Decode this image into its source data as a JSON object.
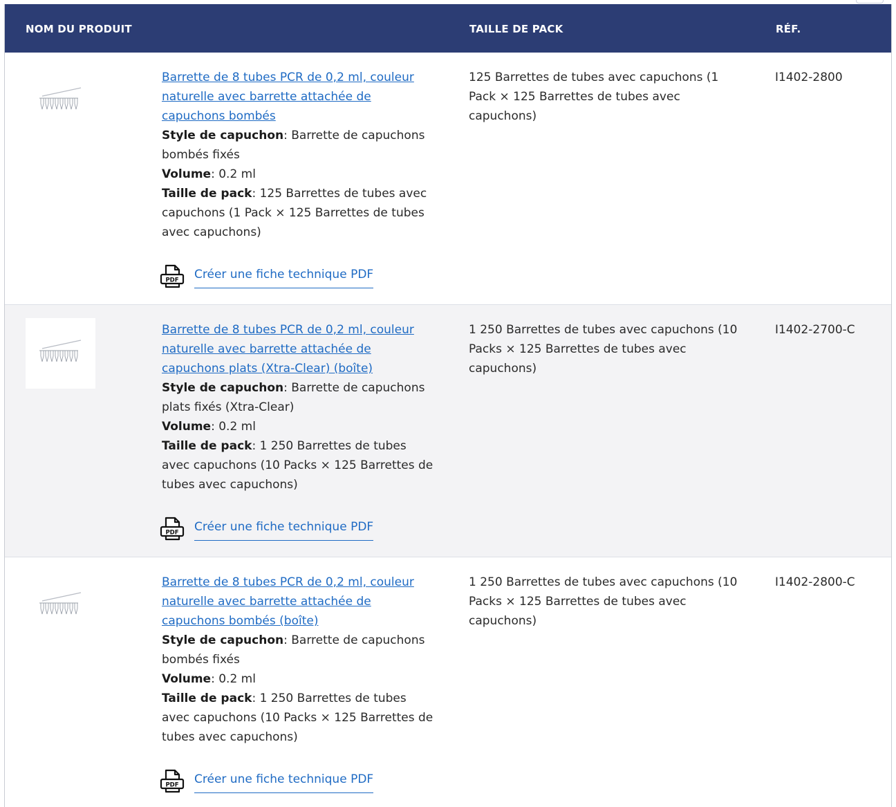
{
  "header": {
    "name": "NOM DU PRODUIT",
    "pack": "TAILLE DE PACK",
    "ref": "RÉF."
  },
  "rows": [
    {
      "title": "Barrette de 8 tubes PCR de 0,2 ml, couleur naturelle avec barrette attachée de capuchons bombés",
      "cap_label": "Style de capuchon",
      "cap_value": ": Barrette de capuchons bombés fixés",
      "volume_label": "Volume",
      "volume_value": ": 0.2 ml",
      "pack_label": "Taille de pack",
      "pack_value": ": 125 Barrettes de tubes avec capuchons (1 Pack × 125 Barrettes de tubes avec capuchons)",
      "pdf_label": "Créer une fiche technique PDF",
      "pack_size": "125 Barrettes de tubes avec capuchons (1 Pack × 125 Barrettes de tubes avec capuchons)",
      "ref": "I1402-2800"
    },
    {
      "title": "Barrette de 8 tubes PCR de 0,2 ml, couleur naturelle avec barrette attachée de capuchons plats (Xtra-Clear) (boîte)",
      "cap_label": "Style de capuchon",
      "cap_value": ": Barrette de capuchons plats fixés (Xtra-Clear)",
      "volume_label": "Volume",
      "volume_value": ": 0.2 ml",
      "pack_label": "Taille de pack",
      "pack_value": ": 1 250 Barrettes de tubes avec capuchons (10 Packs × 125 Barrettes de tubes avec capuchons)",
      "pdf_label": "Créer une fiche technique PDF",
      "pack_size": "1 250 Barrettes de tubes avec capuchons (10 Packs × 125 Barrettes de tubes avec capuchons)",
      "ref": "I1402-2700-C"
    },
    {
      "title": "Barrette de 8 tubes PCR de 0,2 ml, couleur naturelle avec barrette attachée de capuchons bombés (boîte)",
      "cap_label": "Style de capuchon",
      "cap_value": ": Barrette de capuchons bombés fixés",
      "volume_label": "Volume",
      "volume_value": ": 0.2 ml",
      "pack_label": "Taille de pack",
      "pack_value": ": 1 250 Barrettes de tubes avec capuchons (10 Packs × 125 Barrettes de tubes avec capuchons)",
      "pdf_label": "Créer une fiche technique PDF",
      "pack_size": "1 250 Barrettes de tubes avec capuchons (10 Packs × 125 Barrettes de tubes avec capuchons)",
      "ref": "I1402-2800-C"
    }
  ],
  "icons": {
    "product": "pcr-tube-strip-icon",
    "pdf": "pdf-document-icon"
  },
  "colors": {
    "header_bg": "#2c3d74",
    "link": "#1f6bc4",
    "alt_row_bg": "#f3f3f5"
  }
}
